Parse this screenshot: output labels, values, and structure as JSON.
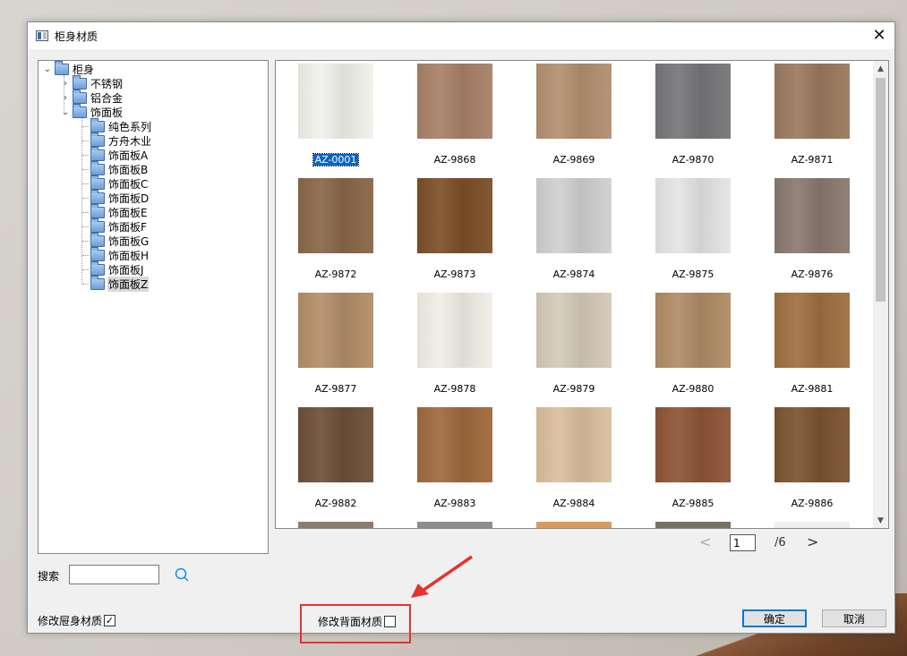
{
  "window": {
    "title": "柜身材质",
    "close_glyph": "✕"
  },
  "tree": {
    "root": "柜身",
    "items": [
      {
        "label": "不锈钢",
        "level": 1,
        "expanded": false
      },
      {
        "label": "铝合金",
        "level": 1,
        "expanded": false
      },
      {
        "label": "饰面板",
        "level": 1,
        "expanded": true
      },
      {
        "label": "纯色系列",
        "level": 2
      },
      {
        "label": "方舟木业",
        "level": 2
      },
      {
        "label": "饰面板A",
        "level": 2
      },
      {
        "label": "饰面板B",
        "level": 2
      },
      {
        "label": "饰面板C",
        "level": 2
      },
      {
        "label": "饰面板D",
        "level": 2
      },
      {
        "label": "饰面板E",
        "level": 2
      },
      {
        "label": "饰面板F",
        "level": 2
      },
      {
        "label": "饰面板G",
        "level": 2
      },
      {
        "label": "饰面板H",
        "level": 2
      },
      {
        "label": "饰面板J",
        "level": 2
      },
      {
        "label": "饰面板Z",
        "level": 2,
        "selected": true
      }
    ]
  },
  "materials": [
    {
      "code": "AZ-0001",
      "color": "#f1f1ec",
      "selected": true
    },
    {
      "code": "AZ-9868",
      "color": "#a98168"
    },
    {
      "code": "AZ-9869",
      "color": "#b48f70"
    },
    {
      "code": "AZ-9870",
      "color": "#77777a"
    },
    {
      "code": "AZ-9871",
      "color": "#9b7a5e"
    },
    {
      "code": "AZ-9872",
      "color": "#8a6748"
    },
    {
      "code": "AZ-9873",
      "color": "#7c5027"
    },
    {
      "code": "AZ-9874",
      "color": "#d0d0d0"
    },
    {
      "code": "AZ-9875",
      "color": "#e4e4e4"
    },
    {
      "code": "AZ-9876",
      "color": "#8a7a70"
    },
    {
      "code": "AZ-9877",
      "color": "#b48e68"
    },
    {
      "code": "AZ-9878",
      "color": "#f0eee6"
    },
    {
      "code": "AZ-9879",
      "color": "#d5cab9"
    },
    {
      "code": "AZ-9880",
      "color": "#b18c66"
    },
    {
      "code": "AZ-9881",
      "color": "#a06f42"
    },
    {
      "code": "AZ-9882",
      "color": "#6e5038"
    },
    {
      "code": "AZ-9883",
      "color": "#a06a3e"
    },
    {
      "code": "AZ-9884",
      "color": "#dbbf9e"
    },
    {
      "code": "AZ-9885",
      "color": "#8e5536"
    },
    {
      "code": "AZ-9886",
      "color": "#7c5430"
    }
  ],
  "partial_row_colors": [
    "#8c7c6c",
    "#8d8d8d",
    "#d89a60",
    "#7a7060",
    "#eeeeee"
  ],
  "pager": {
    "current": "1",
    "total": "/6",
    "prev": "<",
    "next": ">"
  },
  "search": {
    "label": "搜索",
    "value": ""
  },
  "options": {
    "modify_body": {
      "label": "修改屉身材质",
      "checked": true
    },
    "modify_back": {
      "label": "修改背面材质",
      "checked": false
    }
  },
  "buttons": {
    "ok": "确定",
    "cancel": "取消"
  },
  "colors": {
    "selection": "#0a64c8",
    "annotation_red": "#e8312f",
    "accent": "#0078d7"
  }
}
